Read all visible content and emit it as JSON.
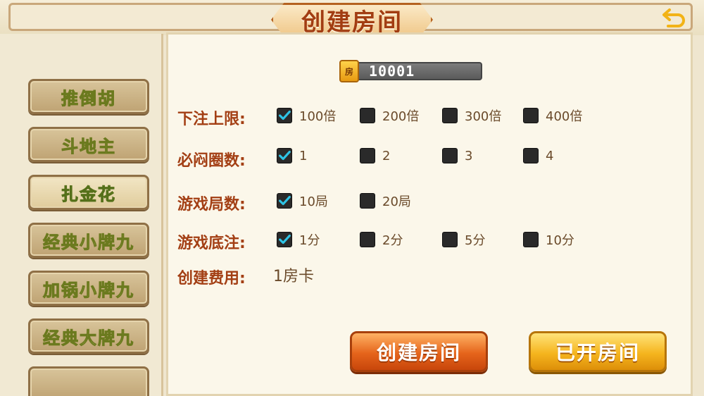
{
  "header": {
    "title": "创建房间",
    "back_icon": "back-arrow-icon"
  },
  "sidebar": {
    "items": [
      {
        "label": "推倒胡",
        "active": false
      },
      {
        "label": "斗地主",
        "active": false
      },
      {
        "label": "扎金花",
        "active": true
      },
      {
        "label": "经典小牌九",
        "active": false
      },
      {
        "label": "加锅小牌九",
        "active": false
      },
      {
        "label": "经典大牌九",
        "active": false
      }
    ]
  },
  "room": {
    "badge": "房",
    "number": "10001"
  },
  "settings": {
    "bet_limit": {
      "label": "下注上限:",
      "options": [
        {
          "label": "100倍",
          "checked": true
        },
        {
          "label": "200倍",
          "checked": false
        },
        {
          "label": "300倍",
          "checked": false
        },
        {
          "label": "400倍",
          "checked": false
        }
      ]
    },
    "rounds_required": {
      "label": "必闷圈数:",
      "options": [
        {
          "label": "1",
          "checked": true
        },
        {
          "label": "2",
          "checked": false
        },
        {
          "label": "3",
          "checked": false
        },
        {
          "label": "4",
          "checked": false
        }
      ]
    },
    "game_rounds": {
      "label": "游戏局数:",
      "options": [
        {
          "label": "10局",
          "checked": true
        },
        {
          "label": "20局",
          "checked": false
        }
      ]
    },
    "base_bet": {
      "label": "游戏底注:",
      "options": [
        {
          "label": "1分",
          "checked": true
        },
        {
          "label": "2分",
          "checked": false
        },
        {
          "label": "5分",
          "checked": false
        },
        {
          "label": "10分",
          "checked": false
        }
      ]
    },
    "cost": {
      "label": "创建费用:",
      "value": "1房卡"
    }
  },
  "actions": {
    "create_label": "创建房间",
    "opened_label": "已开房间"
  },
  "colors": {
    "label": "#a33f14",
    "check": "#2ec4e6",
    "create_button": "#e5641b",
    "opened_button": "#f5b51e"
  }
}
